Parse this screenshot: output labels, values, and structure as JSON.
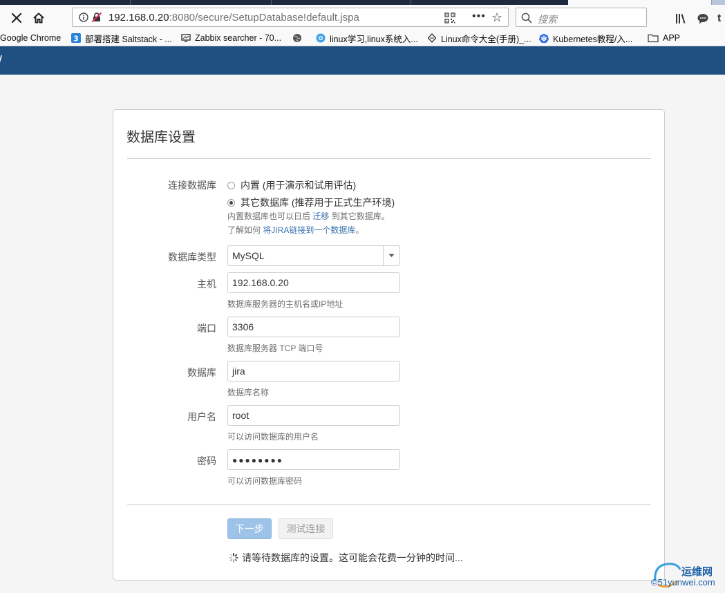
{
  "browser": {
    "url_host": "192.168.0.20",
    "url_rest": ":8080/secure/SetupDatabase!default.jspa",
    "search_placeholder": "搜索",
    "bookmarks": [
      {
        "label": "Google Chrome",
        "icon": "none"
      },
      {
        "label": "部署搭建 Saltstack - ...",
        "icon": "blue-3-icon"
      },
      {
        "label": "Zabbix searcher - 70...",
        "icon": "monitor-icon"
      },
      {
        "label": "",
        "icon": "globe-icon"
      },
      {
        "label": "linux学习,linux系统入...",
        "icon": "blue-circle-icon"
      },
      {
        "label": "Linux命令大全(手册)_...",
        "icon": "diamond-icon"
      },
      {
        "label": "Kubernetes教程/入...",
        "icon": "kubernetes-icon"
      },
      {
        "label": "APP",
        "icon": "folder-icon"
      }
    ]
  },
  "form": {
    "title": "数据库设置",
    "connection_label": "连接数据库",
    "radio_builtin": "内置 (用于演示和试用评估)",
    "radio_other": "其它数据库 (推荐用于正式生产环境)",
    "selected_option": "other",
    "migrate_note_pre": "内置数据库也可以日后",
    "migrate_note_link": "迁移",
    "migrate_note_post": "到其它数据库。",
    "learn_pre": "了解如何",
    "learn_link": "将JIRA链接到一个数据库",
    "learn_post": "。",
    "db_type_label": "数据库类型",
    "db_type_value": "MySQL",
    "host_label": "主机",
    "host_value": "192.168.0.20",
    "host_desc": "数据库服务器的主机名或IP地址",
    "port_label": "端口",
    "port_value": "3306",
    "port_desc": "数据库服务器 TCP 端口号",
    "db_label": "数据库",
    "db_value": "jira",
    "db_desc": "数据库名称",
    "user_label": "用户名",
    "user_value": "root",
    "user_desc": "可以访问数据库的用户名",
    "password_label": "密码",
    "password_mask": "●●●●●●●●",
    "password_desc": "可以访问数据库密码",
    "next_button": "下一步",
    "test_button": "测试连接",
    "waiting_text": "请等待数据库的设置。这可能会花费一分钟的时间..."
  },
  "watermark": {
    "line1": "运维网",
    "line2": "©51yunwei.com"
  },
  "colors": {
    "header": "#205081",
    "link": "#3b73af",
    "primary_button": "#9dc4e8"
  }
}
